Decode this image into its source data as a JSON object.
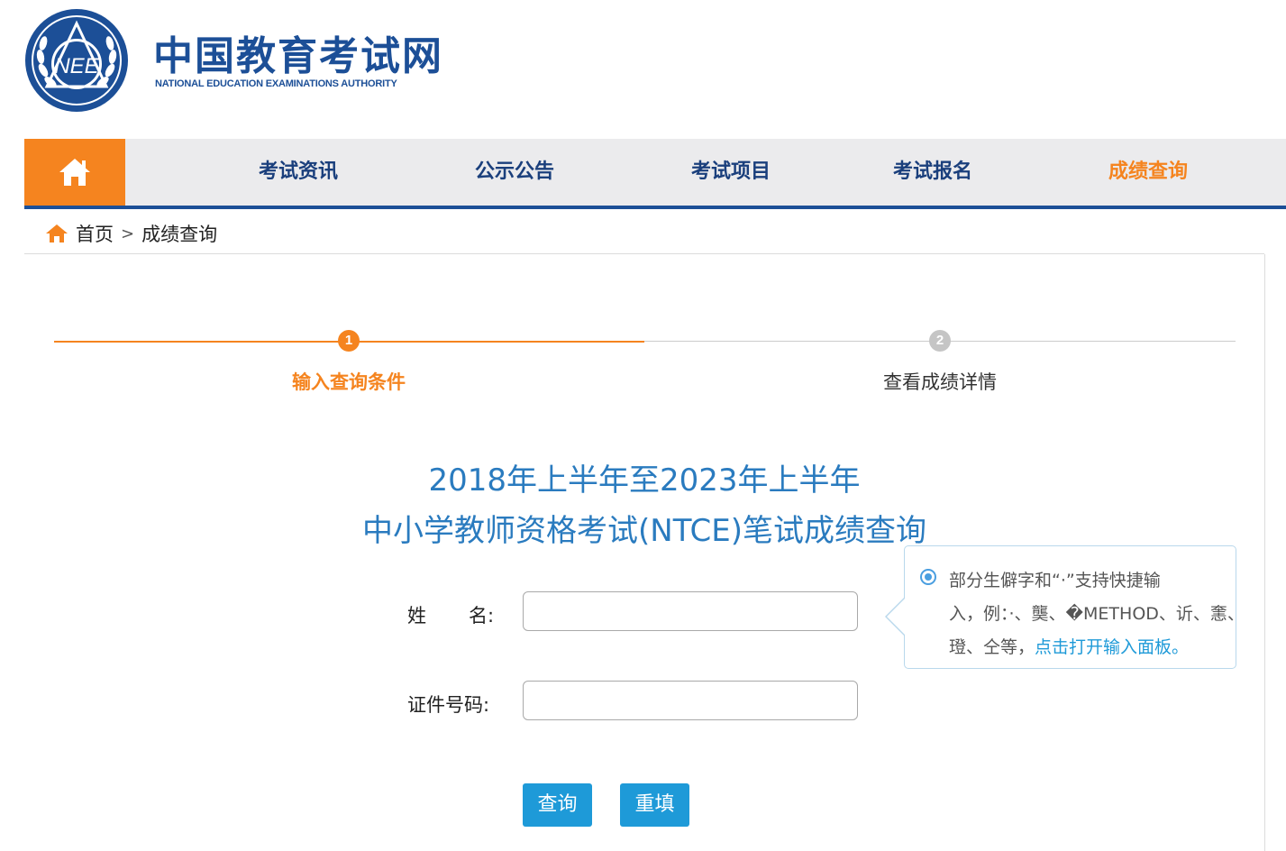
{
  "header": {
    "logo_text": "NEE",
    "title": "中国教育考试网",
    "subtitle": "NATIONAL EDUCATION EXAMINATIONS AUTHORITY"
  },
  "nav": {
    "home_icon": "home-icon",
    "items": [
      {
        "label": "考试资讯"
      },
      {
        "label": "公示公告"
      },
      {
        "label": "考试项目"
      },
      {
        "label": "考试报名"
      },
      {
        "label": "成绩查询",
        "active": true
      }
    ]
  },
  "breadcrumb": {
    "icon": "home-icon",
    "home": "首页",
    "separator": ">",
    "current": "成绩查询"
  },
  "steps": [
    {
      "number": "1",
      "label": "输入查询条件",
      "active": true
    },
    {
      "number": "2",
      "label": "查看成绩详情",
      "active": false
    }
  ],
  "form": {
    "title_line1": "2018年上半年至2023年上半年",
    "title_line2": "中小学教师资格考试(NTCE)笔试成绩查询",
    "name_label_char1": "姓",
    "name_label_char2": "名:",
    "name_value": "",
    "id_label": "证件号码:",
    "id_value": "",
    "query_button": "查询",
    "reset_button": "重填"
  },
  "tooltip": {
    "line1": "部分生僻字和“·”支持快捷输",
    "line2": "入，例：·、龑、�METHOD、䜣、㥣、",
    "line3_text": "璒、仝等，",
    "line3_link": "点击打开输入面板。"
  },
  "colors": {
    "brand_blue": "#1c4f97",
    "accent_orange": "#f5841f",
    "title_blue": "#2a7bbf",
    "button_blue": "#1e9ad8",
    "nav_bg": "#ebebed"
  }
}
